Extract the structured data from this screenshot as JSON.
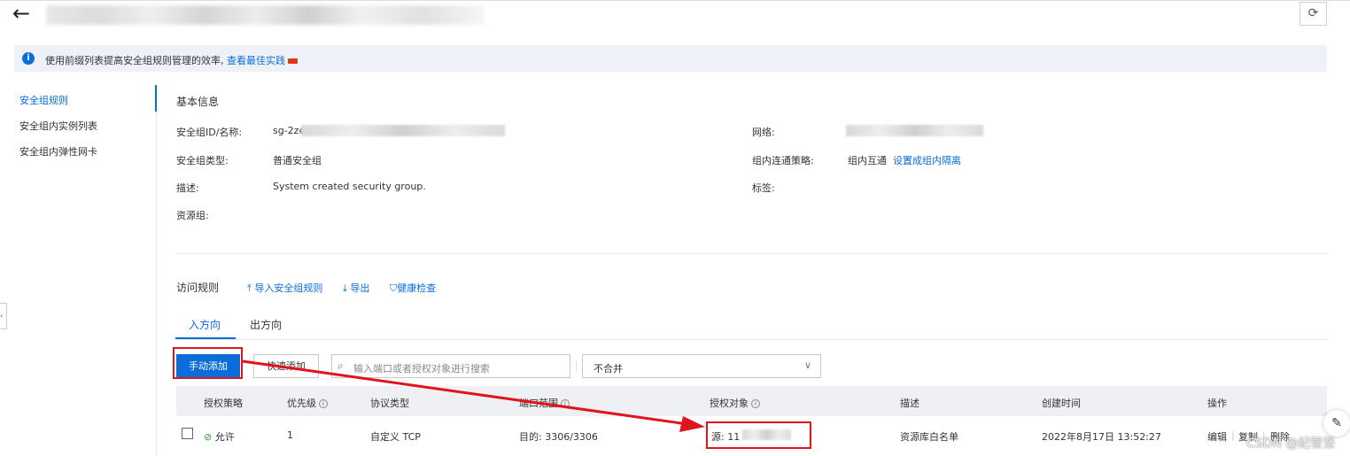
{
  "header": {
    "refresh_glyph": "⟳"
  },
  "notice": {
    "text": "使用前缀列表提高安全组规则管理的效率,",
    "link": "查看最佳实践"
  },
  "sidebar": {
    "items": [
      {
        "label": "安全组规则",
        "active": true
      },
      {
        "label": "安全组内实例列表"
      },
      {
        "label": "安全组内弹性网卡"
      }
    ]
  },
  "basic_info": {
    "title": "基本信息",
    "id_label": "安全组ID/名称:",
    "id_value": "sg-2ze",
    "type_label": "安全组类型:",
    "type_value": "普通安全组",
    "desc_label": "描述:",
    "desc_value": "System created security group.",
    "rg_label": "资源组:",
    "network_label": "网络:",
    "policy_label": "组内连通策略:",
    "policy_value": "组内互通",
    "policy_link": "设置成组内隔离",
    "tag_label": "标签:"
  },
  "rules": {
    "title": "访问规则",
    "import_label": "导入安全组规则",
    "export_label": "导出",
    "health_label": "健康检查",
    "tabs": [
      "入方向",
      "出方向"
    ],
    "add_manual": "手动添加",
    "add_quick": "快速添加",
    "search_placeholder": "输入端口或者授权对象进行搜索",
    "merge_value": "不合并"
  },
  "table": {
    "headers": [
      "授权策略",
      "优先级",
      "协议类型",
      "端口范围",
      "授权对象",
      "描述",
      "创建时间",
      "操作"
    ],
    "rows": [
      {
        "policy": "允许",
        "priority": "1",
        "protocol": "自定义 TCP",
        "port": "目的: 3306/3306",
        "object": "源: 11",
        "desc": "资源库白名单",
        "created": "2022年8月17日 13:52:27",
        "actions": [
          "编辑",
          "复制",
          "删除"
        ]
      }
    ]
  },
  "watermark": "CSDN @纪智坚",
  "colors": {
    "accent": "#0a6dd9",
    "annotation": "#e0141c",
    "allow": "#2ba02b"
  }
}
